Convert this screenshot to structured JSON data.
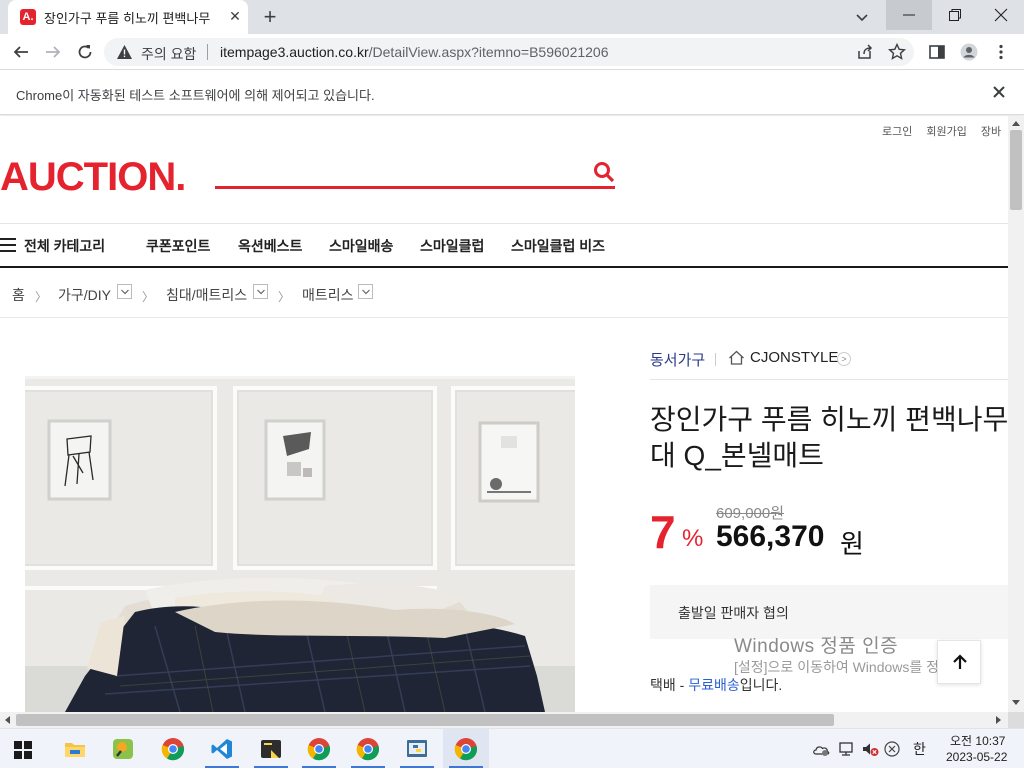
{
  "browser": {
    "tab_title": "장인가구 푸름 히노끼 편백나무",
    "favicon_letter": "A.",
    "security_label": "주의 요함",
    "url_host": "itempage3.auction.co.kr",
    "url_path": "/DetailView.aspx?itemno=B596021206",
    "infobar_text": "Chrome이 자동화된 테스트 소프트웨어에 의해 제어되고 있습니다."
  },
  "site": {
    "util_links": [
      "로그인",
      "회원가입",
      "장바"
    ],
    "logo_text": "AUCTION",
    "logo_dot": ".",
    "brand_color": "#e5232f",
    "all_categories": "전체 카테고리",
    "nav": [
      "쿠폰포인트",
      "옥션베스트",
      "스마일배송",
      "스마일클럽",
      "스마일클럽 비즈"
    ]
  },
  "breadcrumb": {
    "home": "홈",
    "levels": [
      "가구/DIY",
      "침대/매트리스",
      "매트리스"
    ]
  },
  "product": {
    "seller": "동서가구",
    "store": "CJONSTYLE",
    "title": "장인가구 푸름 히노끼 편백나무 대 Q_본넬매트",
    "discount_value": "7",
    "discount_unit": "%",
    "original_price": "609,000원",
    "sale_price": "566,370",
    "sale_currency": "원",
    "shipping_date": "출발일 판매자 협의",
    "delivery_prefix": "택배 - ",
    "delivery_free": "무료배송",
    "delivery_suffix": "입니다."
  },
  "overlay": {
    "activation_title": "Windows 정품 인증",
    "activation_sub": "[설정]으로 이동하여 Windows를 정품"
  },
  "taskbar": {
    "ime": "한",
    "time": "오전 10:37",
    "date": "2023-05-22"
  }
}
